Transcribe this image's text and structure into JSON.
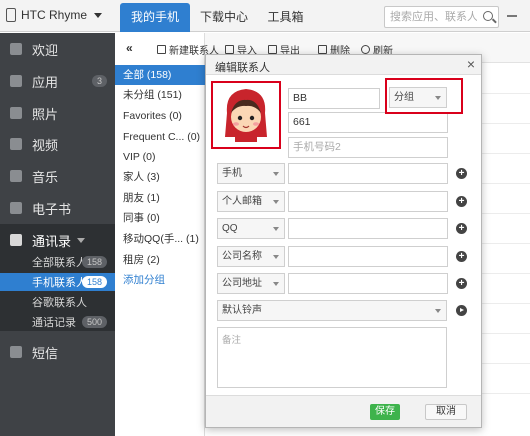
{
  "topbar": {
    "device": "HTC Rhyme",
    "tabs": [
      "我的手机",
      "下载中心",
      "工具箱"
    ],
    "search_placeholder": "搜索应用、联系人"
  },
  "sidebar": {
    "items": [
      {
        "label": "欢迎",
        "icon": "home-icon"
      },
      {
        "label": "应用",
        "icon": "apps-icon",
        "badge": "3"
      },
      {
        "label": "照片",
        "icon": "photo-icon"
      },
      {
        "label": "视频",
        "icon": "video-icon"
      },
      {
        "label": "音乐",
        "icon": "music-icon"
      },
      {
        "label": "电子书",
        "icon": "ebook-icon"
      },
      {
        "label": "通讯录",
        "icon": "contacts-icon"
      },
      {
        "label": "短信",
        "icon": "sms-icon"
      }
    ],
    "subitems": [
      {
        "label": "全部联系人",
        "badge": "158"
      },
      {
        "label": "手机联系人",
        "badge": "158"
      },
      {
        "label": "谷歌联系人",
        "badge": ""
      },
      {
        "label": "通话记录",
        "badge": "500"
      }
    ]
  },
  "groups": {
    "collapse": "«",
    "items": [
      "全部 (158)",
      "未分组 (151)",
      "Favorites (0)",
      "Frequent C... (0)",
      "VIP (0)",
      "家人 (3)",
      "朋友 (1)",
      "同事 (0)",
      "移动QQ(手... (1)",
      "租房 (2)"
    ],
    "add": "添加分组"
  },
  "toolbar": {
    "new_contact": "新建联系人",
    "import": "导入",
    "export": "导出",
    "delete": "删除",
    "refresh": "刷新"
  },
  "dialog": {
    "title": "编辑联系人",
    "close": "×",
    "name": "BB",
    "company": "661",
    "group_select": "分组",
    "phone2_placeholder": "手机号码2",
    "field_types": [
      "手机",
      "个人邮箱",
      "QQ",
      "公司名称",
      "公司地址"
    ],
    "ringtone": "默认铃声",
    "notes_placeholder": "备注",
    "save": "保存",
    "cancel": "取消"
  }
}
